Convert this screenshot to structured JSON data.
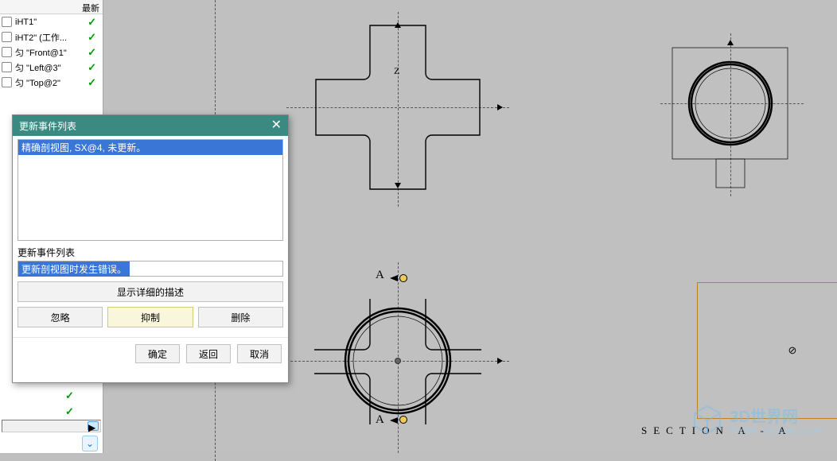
{
  "sidebar": {
    "header": "最新",
    "items": [
      {
        "label": "iHT1\"",
        "check": true
      },
      {
        "label": "iHT2\" (工作...",
        "check": true
      },
      {
        "label": "匀 \"Front@1\"",
        "check": true
      },
      {
        "label": "匀 \"Left@3\"",
        "check": true
      },
      {
        "label": "匀 \"Top@2\"",
        "check": true
      }
    ]
  },
  "dialog": {
    "title": "更新事件列表",
    "close": "✕",
    "list_item": "精确剖视图, SX@4, 未更新。",
    "events_label": "更新事件列表",
    "status_text": "更新剖视图时发生错误。",
    "detail_btn": "显示详细的描述",
    "ignore_btn": "忽略",
    "suppress_btn": "抑制",
    "delete_btn": "删除",
    "ok_btn": "确定",
    "back_btn": "返回",
    "cancel_btn": "取消"
  },
  "drawing": {
    "labelA_top": "A",
    "labelA_bot": "A",
    "labelZ": "Z",
    "labelSym": "⊘",
    "section_label": "SECTION  A - A"
  },
  "watermark": {
    "t1": "3D世界网",
    "t2": "WWW.3DSJW.COM"
  }
}
